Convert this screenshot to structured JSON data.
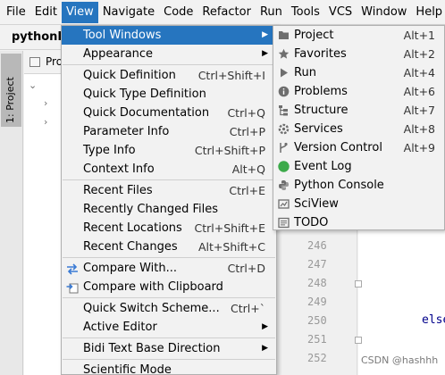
{
  "menubar": [
    {
      "label": "File",
      "active": false
    },
    {
      "label": "Edit",
      "active": false
    },
    {
      "label": "View",
      "active": true
    },
    {
      "label": "Navigate",
      "active": false
    },
    {
      "label": "Code",
      "active": false
    },
    {
      "label": "Refactor",
      "active": false
    },
    {
      "label": "Run",
      "active": false
    },
    {
      "label": "Tools",
      "active": false
    },
    {
      "label": "VCS",
      "active": false
    },
    {
      "label": "Window",
      "active": false
    },
    {
      "label": "Help",
      "active": false
    }
  ],
  "title": "pythonPr",
  "project_panel": {
    "stripe_label": "1: Project",
    "header_label": "Proj"
  },
  "view_menu": {
    "tool_windows": {
      "label": "Tool Windows",
      "shortcut": "",
      "submenu": true
    },
    "appearance": {
      "label": "Appearance",
      "shortcut": "",
      "submenu": true
    },
    "quick_definition": {
      "label": "Quick Definition",
      "shortcut": "Ctrl+Shift+I"
    },
    "quick_type_definition": {
      "label": "Quick Type Definition",
      "shortcut": ""
    },
    "quick_documentation": {
      "label": "Quick Documentation",
      "shortcut": "Ctrl+Q"
    },
    "parameter_info": {
      "label": "Parameter Info",
      "shortcut": "Ctrl+P"
    },
    "type_info": {
      "label": "Type Info",
      "shortcut": "Ctrl+Shift+P"
    },
    "context_info": {
      "label": "Context Info",
      "shortcut": "Alt+Q"
    },
    "recent_files": {
      "label": "Recent Files",
      "shortcut": "Ctrl+E"
    },
    "recently_changed_files": {
      "label": "Recently Changed Files",
      "shortcut": ""
    },
    "recent_locations": {
      "label": "Recent Locations",
      "shortcut": "Ctrl+Shift+E"
    },
    "recent_changes": {
      "label": "Recent Changes",
      "shortcut": "Alt+Shift+C"
    },
    "compare_with": {
      "label": "Compare With...",
      "shortcut": "Ctrl+D"
    },
    "compare_with_clipboard": {
      "label": "Compare with Clipboard",
      "shortcut": ""
    },
    "quick_switch_scheme": {
      "label": "Quick Switch Scheme...",
      "shortcut": "Ctrl+`"
    },
    "active_editor": {
      "label": "Active Editor",
      "shortcut": "",
      "submenu": true
    },
    "bidi_text": {
      "label": "Bidi Text Base Direction",
      "shortcut": "",
      "submenu": true
    },
    "scientific_mode": {
      "label": "Scientific Mode",
      "shortcut": ""
    }
  },
  "tool_windows_submenu": [
    {
      "label": "Project",
      "shortcut": "Alt+1",
      "icon": "folder-icon"
    },
    {
      "label": "Favorites",
      "shortcut": "Alt+2",
      "icon": "star-icon"
    },
    {
      "label": "Run",
      "shortcut": "Alt+4",
      "icon": "play-icon"
    },
    {
      "label": "Problems",
      "shortcut": "Alt+6",
      "icon": "info-icon"
    },
    {
      "label": "Structure",
      "shortcut": "Alt+7",
      "icon": "structure-icon"
    },
    {
      "label": "Services",
      "shortcut": "Alt+8",
      "icon": "services-icon"
    },
    {
      "label": "Version Control",
      "shortcut": "Alt+9",
      "icon": "vcs-icon"
    },
    {
      "label": "Event Log",
      "shortcut": "",
      "icon": "event-log-icon"
    },
    {
      "label": "Python Console",
      "shortcut": "",
      "icon": "python-console-icon"
    },
    {
      "label": "SciView",
      "shortcut": "",
      "icon": "sciview-icon"
    },
    {
      "label": "TODO",
      "shortcut": "",
      "icon": "todo-icon"
    }
  ],
  "editor": {
    "line_numbers": [
      "246",
      "247",
      "248",
      "249",
      "250",
      "251",
      "252"
    ],
    "code_else": "else"
  },
  "watermark": "CSDN @hashhh",
  "colors": {
    "highlight": "#2675bf",
    "event_log_green": "#3caa4a"
  }
}
